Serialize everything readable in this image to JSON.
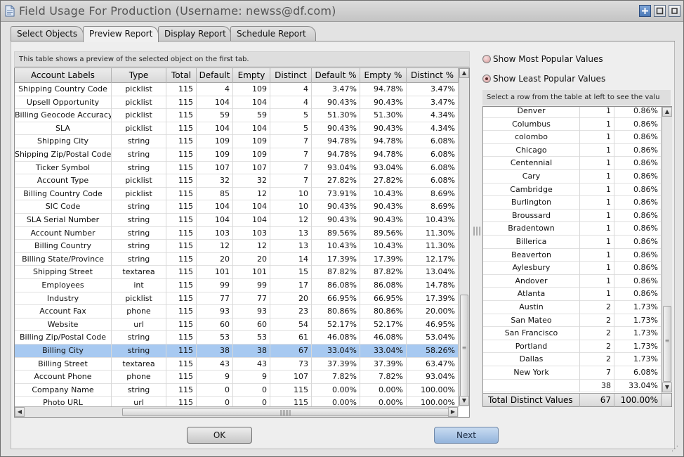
{
  "window": {
    "title": "Field Usage For Production (Username: newss@df.com)"
  },
  "tabs": [
    {
      "label": "Select Objects",
      "active": false
    },
    {
      "label": "Preview Report",
      "active": true
    },
    {
      "label": "Display Report",
      "active": false
    },
    {
      "label": "Schedule Report",
      "active": false
    }
  ],
  "preview": {
    "notice": "This table shows a preview of the selected object on the first tab.",
    "columns": [
      "Account Labels",
      "Type",
      "Total",
      "Default",
      "Empty",
      "Distinct",
      "Default %",
      "Empty %",
      "Distinct %"
    ],
    "rows": [
      [
        "Shipping Country Code",
        "picklist",
        "115",
        "4",
        "109",
        "4",
        "3.47%",
        "94.78%",
        "3.47%"
      ],
      [
        "Upsell Opportunity",
        "picklist",
        "115",
        "104",
        "104",
        "4",
        "90.43%",
        "90.43%",
        "3.47%"
      ],
      [
        "Billing Geocode Accuracy",
        "picklist",
        "115",
        "59",
        "59",
        "5",
        "51.30%",
        "51.30%",
        "4.34%"
      ],
      [
        "SLA",
        "picklist",
        "115",
        "104",
        "104",
        "5",
        "90.43%",
        "90.43%",
        "4.34%"
      ],
      [
        "Shipping City",
        "string",
        "115",
        "109",
        "109",
        "7",
        "94.78%",
        "94.78%",
        "6.08%"
      ],
      [
        "Shipping Zip/Postal Code",
        "string",
        "115",
        "109",
        "109",
        "7",
        "94.78%",
        "94.78%",
        "6.08%"
      ],
      [
        "Ticker Symbol",
        "string",
        "115",
        "107",
        "107",
        "7",
        "93.04%",
        "93.04%",
        "6.08%"
      ],
      [
        "Account Type",
        "picklist",
        "115",
        "32",
        "32",
        "7",
        "27.82%",
        "27.82%",
        "6.08%"
      ],
      [
        "Billing Country Code",
        "picklist",
        "115",
        "85",
        "12",
        "10",
        "73.91%",
        "10.43%",
        "8.69%"
      ],
      [
        "SIC Code",
        "string",
        "115",
        "104",
        "104",
        "10",
        "90.43%",
        "90.43%",
        "8.69%"
      ],
      [
        "SLA Serial Number",
        "string",
        "115",
        "104",
        "104",
        "12",
        "90.43%",
        "90.43%",
        "10.43%"
      ],
      [
        "Account Number",
        "string",
        "115",
        "103",
        "103",
        "13",
        "89.56%",
        "89.56%",
        "11.30%"
      ],
      [
        "Billing Country",
        "string",
        "115",
        "12",
        "12",
        "13",
        "10.43%",
        "10.43%",
        "11.30%"
      ],
      [
        "Billing State/Province",
        "string",
        "115",
        "20",
        "20",
        "14",
        "17.39%",
        "17.39%",
        "12.17%"
      ],
      [
        "Shipping Street",
        "textarea",
        "115",
        "101",
        "101",
        "15",
        "87.82%",
        "87.82%",
        "13.04%"
      ],
      [
        "Employees",
        "int",
        "115",
        "99",
        "99",
        "17",
        "86.08%",
        "86.08%",
        "14.78%"
      ],
      [
        "Industry",
        "picklist",
        "115",
        "77",
        "77",
        "20",
        "66.95%",
        "66.95%",
        "17.39%"
      ],
      [
        "Account Fax",
        "phone",
        "115",
        "93",
        "93",
        "23",
        "80.86%",
        "80.86%",
        "20.00%"
      ],
      [
        "Website",
        "url",
        "115",
        "60",
        "60",
        "54",
        "52.17%",
        "52.17%",
        "46.95%"
      ],
      [
        "Billing Zip/Postal Code",
        "string",
        "115",
        "53",
        "53",
        "61",
        "46.08%",
        "46.08%",
        "53.04%"
      ],
      [
        "Billing City",
        "string",
        "115",
        "38",
        "38",
        "67",
        "33.04%",
        "33.04%",
        "58.26%"
      ],
      [
        "Billing Street",
        "textarea",
        "115",
        "43",
        "43",
        "73",
        "37.39%",
        "37.39%",
        "63.47%"
      ],
      [
        "Account Phone",
        "phone",
        "115",
        "9",
        "9",
        "107",
        "7.82%",
        "7.82%",
        "93.04%"
      ],
      [
        "Company Name",
        "string",
        "115",
        "0",
        "0",
        "115",
        "0.00%",
        "0.00%",
        "100.00%"
      ],
      [
        "Photo URL",
        "url",
        "115",
        "0",
        "0",
        "115",
        "0.00%",
        "0.00%",
        "100.00%"
      ]
    ],
    "selected_row": 20
  },
  "values_panel": {
    "radio_most": "Show Most Popular Values",
    "radio_least": "Show Least Popular Values",
    "selected_option": "least",
    "notice": "Select a row from the table at left to see the valu",
    "rows": [
      [
        "Denver",
        "1",
        "0.86%"
      ],
      [
        "Columbus",
        "1",
        "0.86%"
      ],
      [
        "colombo",
        "1",
        "0.86%"
      ],
      [
        "Chicago",
        "1",
        "0.86%"
      ],
      [
        "Centennial",
        "1",
        "0.86%"
      ],
      [
        "Cary",
        "1",
        "0.86%"
      ],
      [
        "Cambridge",
        "1",
        "0.86%"
      ],
      [
        "Burlington",
        "1",
        "0.86%"
      ],
      [
        "Broussard",
        "1",
        "0.86%"
      ],
      [
        "Bradentown",
        "1",
        "0.86%"
      ],
      [
        "Billerica",
        "1",
        "0.86%"
      ],
      [
        "Beaverton",
        "1",
        "0.86%"
      ],
      [
        "Aylesbury",
        "1",
        "0.86%"
      ],
      [
        "Andover",
        "1",
        "0.86%"
      ],
      [
        "Atlanta",
        "1",
        "0.86%"
      ],
      [
        "Austin",
        "2",
        "1.73%"
      ],
      [
        "San Mateo",
        "2",
        "1.73%"
      ],
      [
        "San Francisco",
        "2",
        "1.73%"
      ],
      [
        "Portland",
        "2",
        "1.73%"
      ],
      [
        "Dallas",
        "2",
        "1.73%"
      ],
      [
        "New York",
        "7",
        "6.08%"
      ],
      [
        "",
        "38",
        "33.04%"
      ]
    ],
    "footer": {
      "label": "Total Distinct Values",
      "count": "67",
      "percent": "100.00%"
    }
  },
  "buttons": {
    "ok": "OK",
    "next": "Next"
  },
  "colors": {
    "selection": "#a7c9f1",
    "next_button": "#93b4dc"
  }
}
